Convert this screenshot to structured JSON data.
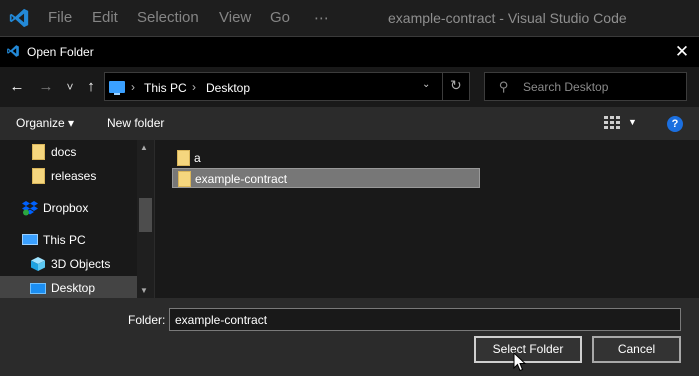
{
  "vscode": {
    "menus": [
      "File",
      "Edit",
      "Selection",
      "View",
      "Go",
      "⋯"
    ],
    "window_title": "example-contract - Visual Studio Code",
    "logo_icon": "vscode-logo-icon",
    "accent": "#2389d7"
  },
  "dialog": {
    "title": "Open Folder",
    "close_label": "✕",
    "nav": {
      "back": "←",
      "forward": "→",
      "recent": "˅",
      "up": "↑"
    },
    "address": {
      "crumbs": [
        "This PC",
        "Desktop"
      ],
      "separator": "›",
      "dropdown": "⌄",
      "refresh": "↻"
    },
    "search": {
      "placeholder": "Search Desktop",
      "value": ""
    },
    "toolbar": {
      "organize_label": "Organize ▾",
      "new_folder_label": "New folder",
      "view_dropdown": "▼",
      "help_label": "?"
    },
    "sidebar": {
      "items": [
        {
          "label": "docs",
          "icon": "folder-icon"
        },
        {
          "label": "releases",
          "icon": "folder-icon"
        },
        {
          "label": "Dropbox",
          "icon": "dropbox-icon"
        },
        {
          "label": "This PC",
          "icon": "pc-icon"
        },
        {
          "label": "3D Objects",
          "icon": "3d-objects-icon"
        },
        {
          "label": "Desktop",
          "icon": "desktop-icon",
          "selected": true
        }
      ]
    },
    "files": [
      {
        "name": "a",
        "icon": "folder-icon",
        "selected": false
      },
      {
        "name": "example-contract",
        "icon": "folder-icon",
        "selected": true
      }
    ],
    "footer": {
      "folder_label": "Folder:",
      "folder_value": "example-contract",
      "select_button": "Select Folder",
      "cancel_button": "Cancel"
    }
  },
  "colors": {
    "background": "#2b2b2b",
    "pane": "#191919",
    "titlebar": "#000000",
    "selection": "#777777",
    "folder": "#f5d67e",
    "help": "#1b6fe0",
    "dropbox": "#0061fe",
    "pc": "#3aa0ff"
  }
}
